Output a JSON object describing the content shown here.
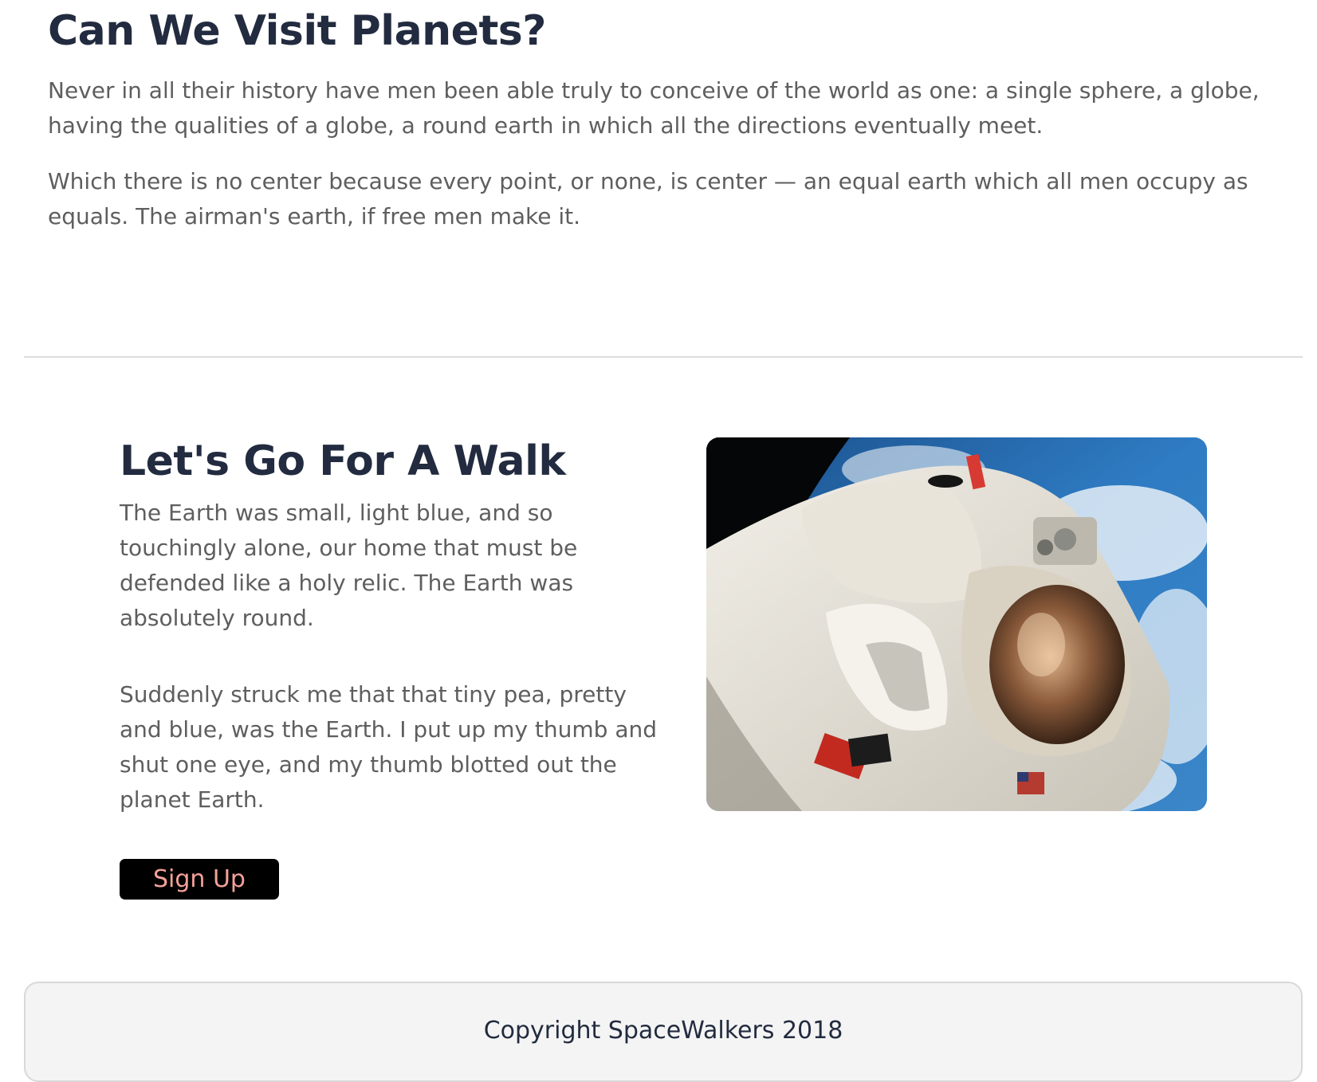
{
  "intro": {
    "title": "Can We Visit Planets?",
    "paragraph1": "Never in all their history have men been able truly to conceive of the world as one: a single sphere, a globe, having the qualities of a globe, a round earth in which all the directions eventually meet.",
    "paragraph2": "Which there is no center because every point, or none, is center — an equal earth which all men occupy as equals. The airman's earth, if free men make it."
  },
  "walk": {
    "title": "Let's Go For A Walk",
    "paragraph1": "The Earth was small, light blue, and so touchingly alone, our home that must be defended like a holy relic. The Earth was absolutely round.",
    "paragraph2": "Suddenly struck me that that tiny pea, pretty and blue, was the Earth. I put up my thumb and shut one eye, and my thumb blotted out the planet Earth.",
    "signup_label": "Sign Up",
    "image_subject": "astronaut-spacewalk-photo"
  },
  "footer": {
    "copyright": "Copyright SpaceWalkers 2018"
  },
  "colors": {
    "heading": "#222b3f",
    "body_text": "#5e5e5e",
    "button_bg": "#000000",
    "button_text": "#f4a29a",
    "footer_bg": "#f4f4f4"
  }
}
